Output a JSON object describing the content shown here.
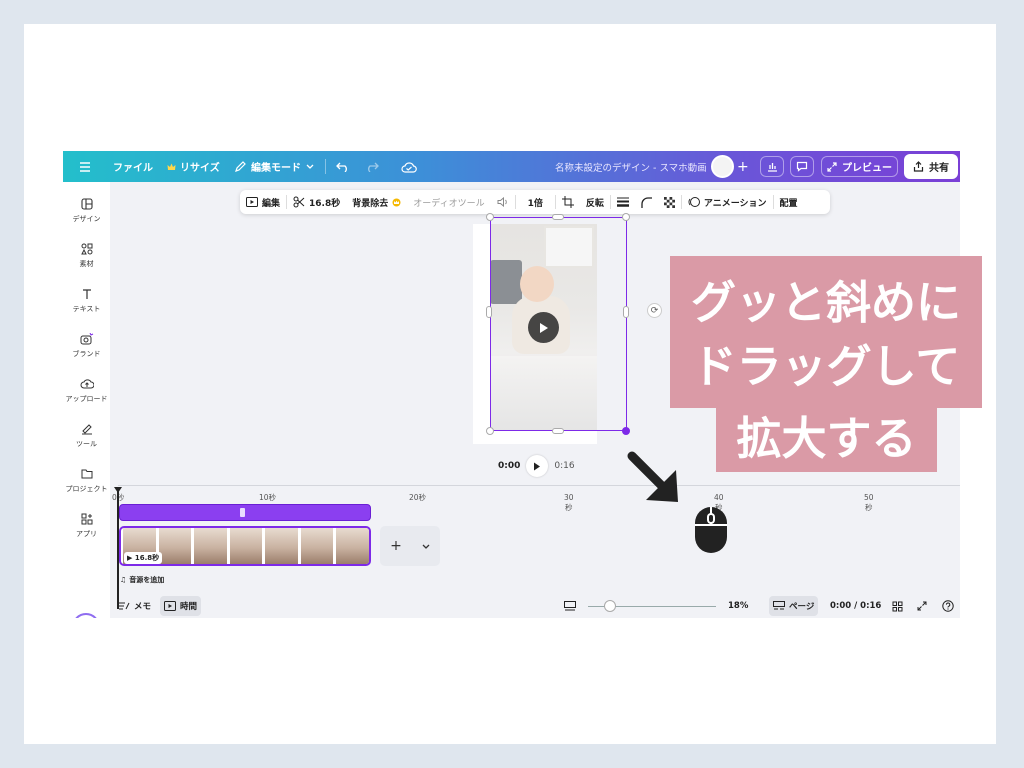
{
  "topbar": {
    "file": "ファイル",
    "resize": "リサイズ",
    "edit_mode": "編集モード",
    "doc_title": "名称未設定のデザイン - スマホ動画",
    "preview": "プレビュー",
    "share": "共有"
  },
  "sidebar": {
    "items": [
      {
        "label": "デザイン",
        "icon": "design-icon"
      },
      {
        "label": "素材",
        "icon": "elements-icon"
      },
      {
        "label": "テキスト",
        "icon": "text-icon"
      },
      {
        "label": "ブランド",
        "icon": "brand-icon"
      },
      {
        "label": "アップロード",
        "icon": "upload-icon"
      },
      {
        "label": "ツール",
        "icon": "draw-icon"
      },
      {
        "label": "プロジェクト",
        "icon": "folder-icon"
      },
      {
        "label": "アプリ",
        "icon": "apps-icon"
      }
    ]
  },
  "toolbar": {
    "edit": "編集",
    "duration": "16.8秒",
    "bg_remove": "背景除去",
    "audio_tool": "オーディオツール",
    "speed": "1倍",
    "flip": "反転",
    "animation": "アニメーション",
    "position": "配置"
  },
  "player": {
    "current": "0:00",
    "total": "0:16"
  },
  "timeline": {
    "ticks": [
      {
        "label": "0秒"
      },
      {
        "label": "10秒"
      },
      {
        "label": "20秒"
      },
      {
        "label": "30",
        "sub": "秒"
      },
      {
        "label": "40",
        "sub": "秒"
      },
      {
        "label": "50",
        "sub": "秒"
      }
    ],
    "clip_duration": "16.8秒",
    "add_audio": "音源を追加"
  },
  "bottombar": {
    "notes": "メモ",
    "timing": "時間",
    "zoom_percent": "18%",
    "zoom_level": 0.18,
    "pages": "ページ",
    "time_display": "0:00 / 0:16"
  },
  "annotation": {
    "line1": "グッと斜めに",
    "line2": "ドラッグして",
    "line3": "拡大する"
  },
  "colors": {
    "accent": "#7d2ae8",
    "note_bg": "#da9aa6",
    "topbar_start": "#23bfcb",
    "topbar_end": "#7a3fd6"
  }
}
